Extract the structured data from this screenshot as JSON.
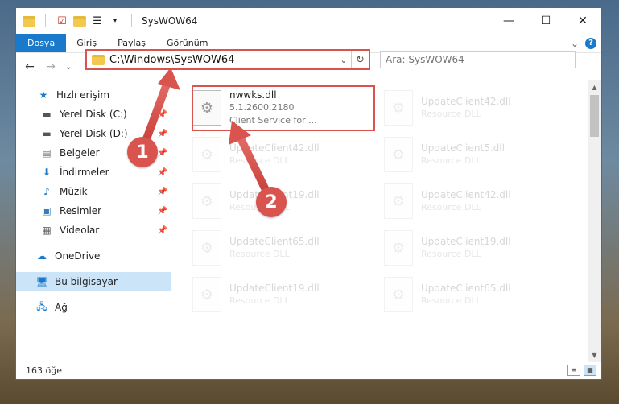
{
  "window": {
    "title": "SysWOW64",
    "controls": {
      "minimize": "—",
      "maximize": "☐",
      "close": "✕"
    }
  },
  "ribbon": {
    "tabs": [
      "Dosya",
      "Giriş",
      "Paylaş",
      "Görünüm"
    ],
    "expand": "⌄",
    "help": "?"
  },
  "navbar": {
    "back": "←",
    "forward": "→",
    "recent": "⌄",
    "up": "↑",
    "address": "C:\\Windows\\SysWOW64",
    "address_dropdown": "⌄",
    "refresh": "↻",
    "search_placeholder": "Ara: SysWOW64"
  },
  "sidebar": {
    "quick_access": "Hızlı erişim",
    "items": [
      {
        "label": "Yerel Disk (C:)",
        "icon": "drive-icon"
      },
      {
        "label": "Yerel Disk (D:)",
        "icon": "drive-icon"
      },
      {
        "label": "Belgeler",
        "icon": "documents-icon"
      },
      {
        "label": "İndirmeler",
        "icon": "downloads-icon"
      },
      {
        "label": "Müzik",
        "icon": "music-icon"
      },
      {
        "label": "Resimler",
        "icon": "pictures-icon"
      },
      {
        "label": "Videolar",
        "icon": "videos-icon"
      }
    ],
    "onedrive": "OneDrive",
    "this_pc": "Bu bilgisayar",
    "network": "Ağ"
  },
  "files": [
    {
      "name": "nwwks.dll",
      "line2": "5.1.2600.2180",
      "line3": "Client Service for ...",
      "highlighted": true
    },
    {
      "name": "UpdateClient42.dll",
      "line2": "Resource DLL"
    },
    {
      "name": "UpdateClient42.dll",
      "line2": "Resource DLL"
    },
    {
      "name": "UpdateClient5.dll",
      "line2": "Resource DLL"
    },
    {
      "name": "UpdateClient19.dll",
      "line2": "Resource DLL"
    },
    {
      "name": "UpdateClient42.dll",
      "line2": "Resource DLL"
    },
    {
      "name": "UpdateClient65.dll",
      "line2": "Resource DLL"
    },
    {
      "name": "UpdateClient19.dll",
      "line2": "Resource DLL"
    },
    {
      "name": "UpdateClient19.dll",
      "line2": "Resource DLL"
    },
    {
      "name": "UpdateClient65.dll",
      "line2": "Resource DLL"
    }
  ],
  "status": {
    "count": "163 öğe"
  },
  "annotations": {
    "badge1": "1",
    "badge2": "2",
    "color": "#d9534f"
  }
}
